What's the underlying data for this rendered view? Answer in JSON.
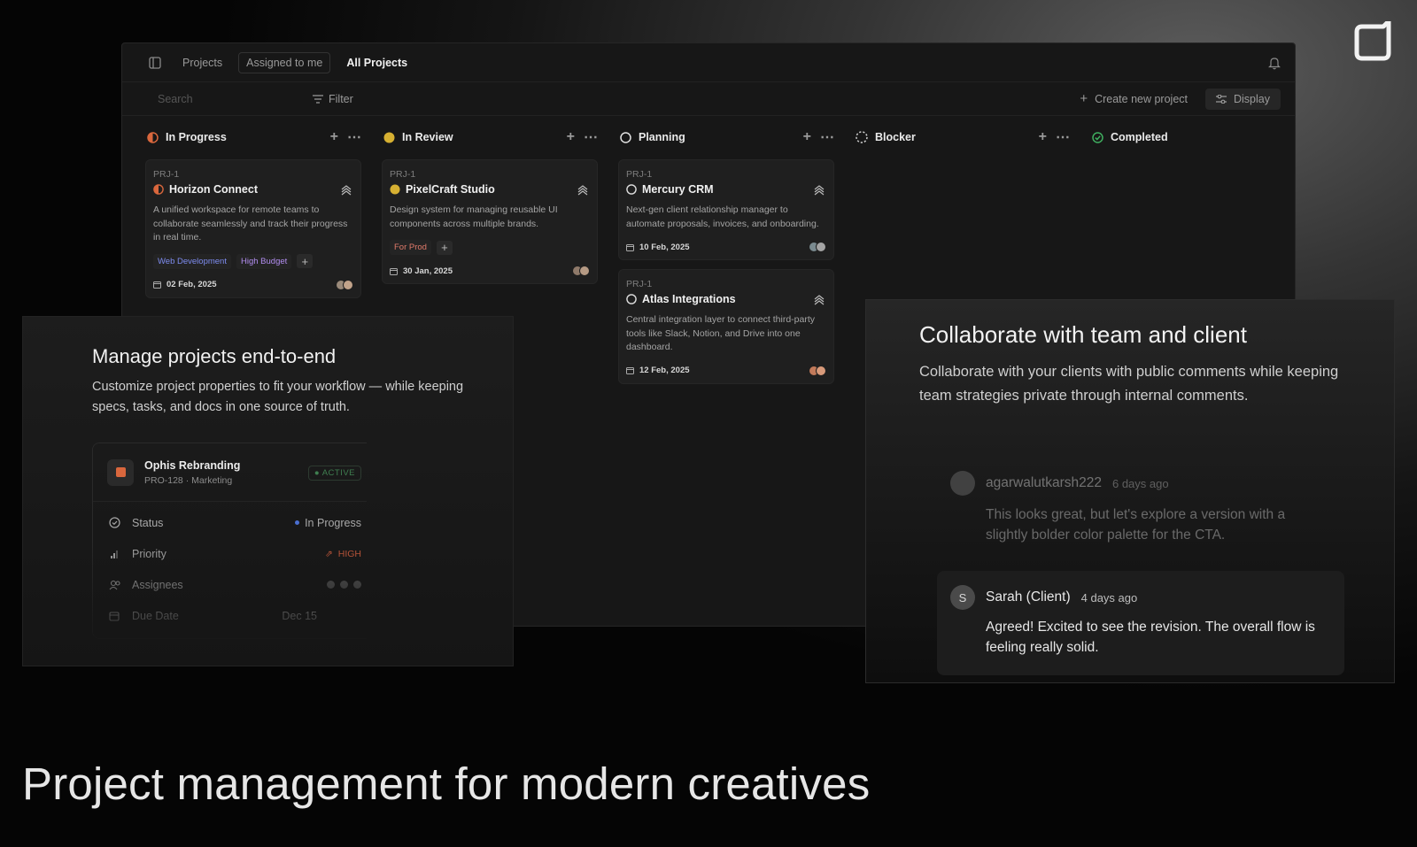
{
  "topbar": {
    "projects": "Projects",
    "assigned": "Assigned to me",
    "all": "All Projects"
  },
  "toolbar": {
    "search_placeholder": "Search",
    "filter": "Filter",
    "create": "Create new project",
    "display": "Display"
  },
  "columns": [
    {
      "name": "In Progress",
      "status_color": "#d9673d"
    },
    {
      "name": "In Review",
      "status_color": "#d6b032"
    },
    {
      "name": "Planning",
      "status_color": "#e0e0e0"
    },
    {
      "name": "Blocker",
      "status_color": "#cfcfcf"
    },
    {
      "name": "Completed",
      "status_color": "#3fae5f"
    }
  ],
  "cards": {
    "horizon": {
      "id": "PRJ-1",
      "title": "Horizon Connect",
      "desc": "A unified workspace for remote teams to collaborate seamlessly and track their progress in real time.",
      "tag1": "Web Development",
      "tag2": "High Budget",
      "date": "02 Feb, 2025"
    },
    "pixel": {
      "id": "PRJ-1",
      "title": "PixelCraft Studio",
      "desc": "Design system for managing reusable UI components across multiple brands.",
      "tag1": "For Prod",
      "date": "30 Jan, 2025"
    },
    "mercury": {
      "id": "PRJ-1",
      "title": "Mercury CRM",
      "desc": "Next-gen client relationship manager to automate proposals, invoices, and onboarding.",
      "date": "10 Feb, 2025"
    },
    "atlas": {
      "id": "PRJ-1",
      "title": "Atlas Integrations",
      "desc": "Central integration layer to connect third-party tools like Slack, Notion, and Drive into one dashboard.",
      "date": "12 Feb, 2025"
    }
  },
  "feature_left": {
    "heading": "Manage projects end-to-end",
    "text": "Customize project properties to fit your workflow — while keeping specs, tasks, and docs in one source of truth.",
    "project": {
      "name": "Ophis Rebranding",
      "code": "PRO-128",
      "team": "Marketing",
      "badge": "ACTIVE",
      "status_label": "Status",
      "status_value": "In Progress",
      "priority_label": "Priority",
      "priority_value": "HIGH",
      "assignees_label": "Assignees",
      "due_label": "Due Date",
      "due_value": "Dec 15"
    }
  },
  "feature_right": {
    "heading": "Collaborate with team and client",
    "text": "Collaborate with your clients with public comments while keeping team strategies private through internal comments.",
    "comment1": {
      "author": "agarwalutkarsh222",
      "time": "6 days ago",
      "body": "This looks great, but let's explore a version with a slightly bolder color palette for the CTA."
    },
    "comment2": {
      "initial": "S",
      "author": "Sarah (Client)",
      "time": "4 days ago",
      "body": "Agreed! Excited to see the revision. The overall flow is feeling really solid."
    }
  },
  "tagline": "Project management for modern creatives",
  "colors": {
    "tag_web": "#7e8cf0",
    "tag_budget": "#b28df0",
    "tag_prod": "#e07a6a",
    "active_badge": "#3f7f50",
    "priority_high": "#c85a3c"
  }
}
